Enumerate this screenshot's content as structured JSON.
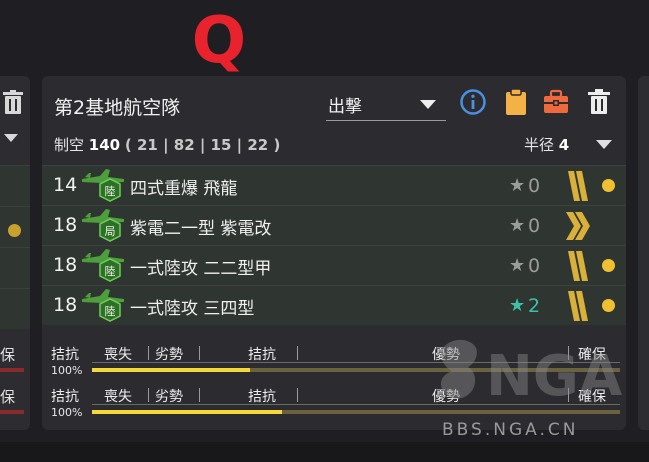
{
  "overlay": {
    "q_mark": "Q"
  },
  "card": {
    "title": "第2基地航空隊",
    "mode": {
      "selected": "出撃"
    },
    "icons": {
      "info": "info-icon",
      "clipboard": "clipboard-icon",
      "toolbox": "toolbox-icon",
      "trash": "trash-icon"
    },
    "airpower": {
      "label": "制空",
      "value": "140",
      "breakdown": "( 21 | 82 | 15 | 22 )"
    },
    "radius": {
      "label": "半径",
      "value": "4"
    },
    "slots": [
      {
        "count": "14",
        "icon_badge": "陸",
        "name": "四式重爆 飛龍",
        "level": "0",
        "level_color": "#9c9c9c",
        "proficiency": "double-bar",
        "dot": true
      },
      {
        "count": "18",
        "icon_badge": "局",
        "name": "紫電二一型 紫電改",
        "level": "0",
        "level_color": "#9c9c9c",
        "proficiency": "double-chevron",
        "dot": false
      },
      {
        "count": "18",
        "icon_badge": "陸",
        "name": "一式陸攻 二二型甲",
        "level": "0",
        "level_color": "#9c9c9c",
        "proficiency": "double-bar",
        "dot": true
      },
      {
        "count": "18",
        "icon_badge": "陸",
        "name": "一式陸攻 三四型",
        "level": "2",
        "level_color": "#3cc1a9",
        "proficiency": "double-bar",
        "dot": true
      }
    ],
    "gauges": [
      {
        "percent": "100%",
        "fill_fraction": 0.3,
        "labels": {
          "parity": "拮抗",
          "loss": "喪失",
          "denial": "劣勢",
          "parity2": "拮抗",
          "superiority": "優勢",
          "supremacy": "確保"
        }
      },
      {
        "percent": "100%",
        "fill_fraction": 0.36,
        "labels": {
          "parity": "拮抗",
          "loss": "喪失",
          "denial": "劣勢",
          "parity2": "拮抗",
          "superiority": "優勢",
          "supremacy": "確保"
        }
      }
    ]
  },
  "left_panel": {
    "labels": [
      "保",
      "保"
    ]
  },
  "watermark": {
    "logo": "NGA",
    "text": "BBS.NGA.CN"
  },
  "colors": {
    "accent_red": "#e8232d",
    "bar_yellow": "#f5d83a",
    "dot_gold": "#f0c030",
    "teal": "#3cc1a9"
  }
}
